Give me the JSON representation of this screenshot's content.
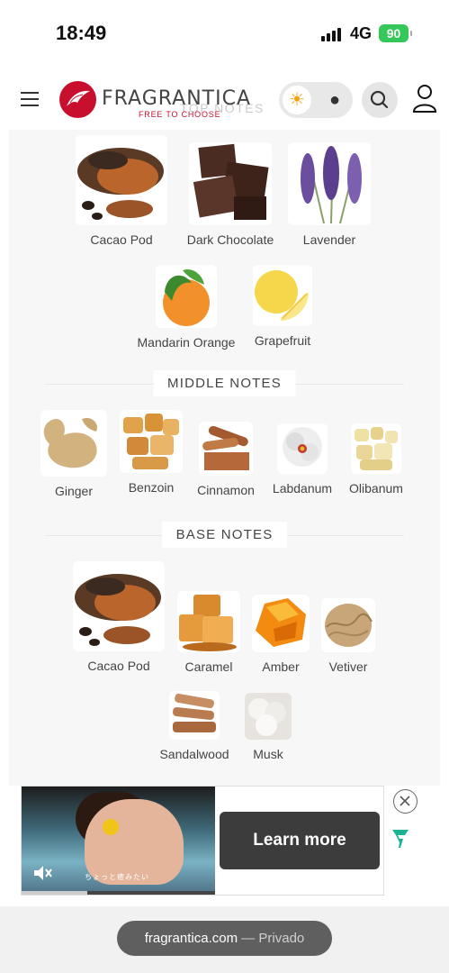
{
  "status": {
    "time": "18:49",
    "network": "4G",
    "battery": "90"
  },
  "header": {
    "brand": "FRAGRANTICA",
    "tagline": "FREE TO CHOOSE",
    "ghost_heading": "TOP NOTES"
  },
  "top_notes": [
    {
      "label": "Cacao Pod"
    },
    {
      "label": "Dark Chocolate"
    },
    {
      "label": "Lavender"
    },
    {
      "label": "Mandarin Orange"
    },
    {
      "label": "Grapefruit"
    }
  ],
  "middle": {
    "heading": "MIDDLE NOTES",
    "notes": [
      {
        "label": "Ginger"
      },
      {
        "label": "Benzoin"
      },
      {
        "label": "Cinnamon"
      },
      {
        "label": "Labdanum"
      },
      {
        "label": "Olibanum"
      }
    ]
  },
  "base": {
    "heading": "BASE NOTES",
    "notes": [
      {
        "label": "Cacao Pod"
      },
      {
        "label": "Caramel"
      },
      {
        "label": "Amber"
      },
      {
        "label": "Vetiver"
      },
      {
        "label": "Sandalwood"
      },
      {
        "label": "Musk"
      }
    ]
  },
  "ad": {
    "cta": "Learn more",
    "caption": "ちょっと癒みたい",
    "progress": 0.34
  },
  "browser": {
    "domain": "fragrantica.com",
    "mode": "— Privado"
  },
  "colors": {
    "brand": "#c8102e",
    "battery": "#34c759",
    "ad_logo": "#1ab394"
  }
}
